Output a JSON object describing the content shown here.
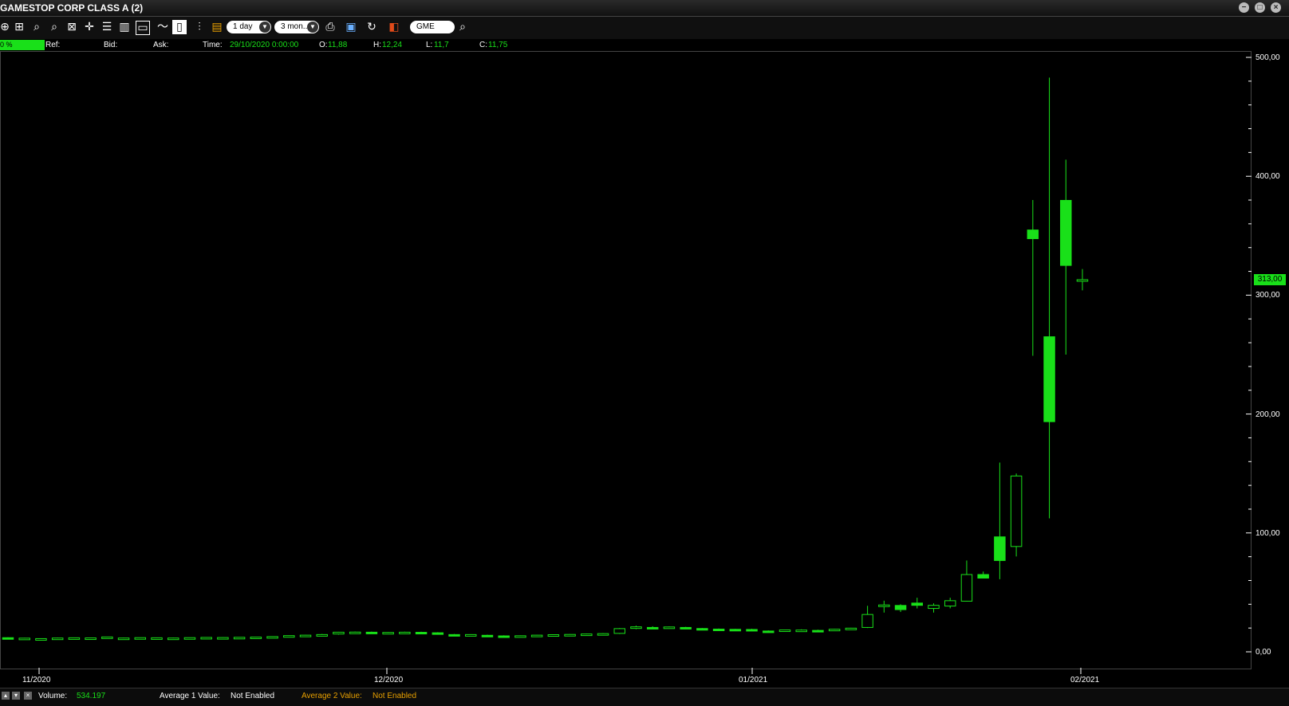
{
  "window": {
    "title": "GAMESTOP CORP CLASS A (2)"
  },
  "toolbar": {
    "interval": "1 day",
    "range": "3 mon..",
    "symbol": "GME",
    "icons": [
      "zoom-in-icon",
      "zoom-fit-icon",
      "zoom-in-alt-icon",
      "zoom-out-icon",
      "zoom-reset-icon",
      "crosshair-icon",
      "list-icon",
      "grid-icon",
      "window-icon",
      "line-chart-icon",
      "candlestick-icon",
      "bars-icon",
      "settings-icon",
      "print-icon",
      "save-icon",
      "refresh-icon",
      "color-icon",
      "search-icon"
    ]
  },
  "info": {
    "pct": "0 %",
    "ref_label": "Ref:",
    "bid_label": "Bid:",
    "ask_label": "Ask:",
    "time_label": "Time:",
    "time_value": "29/10/2020 0:00:00",
    "open_label": "O:",
    "open_value": "11,88",
    "high_label": "H:",
    "high_value": "12,24",
    "low_label": "L:",
    "low_value": "11,7",
    "close_label": "C:",
    "close_value": "11,75"
  },
  "axis": {
    "y_ticks": [
      "500,00",
      "400,00",
      "300,00",
      "200,00",
      "100,00",
      "0,00"
    ],
    "x_ticks": [
      "11/2020",
      "12/2020",
      "01/2021",
      "02/2021"
    ],
    "last_price": "313,00"
  },
  "bottom": {
    "volume_label": "Volume:",
    "volume_value": "534.197",
    "avg1_label": "Average 1 Value:",
    "avg1_value": "Not Enabled",
    "avg2_label": "Average 2 Value:",
    "avg2_value": "Not Enabled"
  },
  "colors": {
    "up": "#19e019",
    "background": "#000000",
    "axis": "#ffffff"
  },
  "chart_data": {
    "type": "candlestick",
    "title": "GAMESTOP CORP CLASS A (2)",
    "ylim": [
      0,
      500
    ],
    "x_ticks": [
      "11/2020",
      "12/2020",
      "01/2021",
      "02/2021"
    ],
    "candles": [
      {
        "o": 11.88,
        "h": 12.24,
        "l": 11.7,
        "c": 11.75
      },
      {
        "o": 11.2,
        "h": 11.8,
        "l": 10.9,
        "c": 11.5
      },
      {
        "o": 10.9,
        "h": 11.4,
        "l": 10.5,
        "c": 11.1
      },
      {
        "o": 11.2,
        "h": 11.9,
        "l": 10.9,
        "c": 11.6
      },
      {
        "o": 11.5,
        "h": 12.0,
        "l": 11.1,
        "c": 11.8
      },
      {
        "o": 11.3,
        "h": 11.9,
        "l": 11.0,
        "c": 11.7
      },
      {
        "o": 12.1,
        "h": 12.7,
        "l": 11.7,
        "c": 12.5
      },
      {
        "o": 11.4,
        "h": 11.9,
        "l": 11.0,
        "c": 11.6
      },
      {
        "o": 11.6,
        "h": 12.1,
        "l": 11.2,
        "c": 11.9
      },
      {
        "o": 11.5,
        "h": 12.0,
        "l": 11.2,
        "c": 11.8
      },
      {
        "o": 11.3,
        "h": 11.9,
        "l": 11.0,
        "c": 11.6
      },
      {
        "o": 11.6,
        "h": 12.1,
        "l": 11.3,
        "c": 11.9
      },
      {
        "o": 11.8,
        "h": 12.3,
        "l": 11.4,
        "c": 12.1
      },
      {
        "o": 11.7,
        "h": 12.2,
        "l": 11.4,
        "c": 12.0
      },
      {
        "o": 11.9,
        "h": 12.4,
        "l": 11.6,
        "c": 12.2
      },
      {
        "o": 12.0,
        "h": 12.6,
        "l": 11.7,
        "c": 12.4
      },
      {
        "o": 12.4,
        "h": 13.0,
        "l": 12.0,
        "c": 12.8
      },
      {
        "o": 13.0,
        "h": 13.8,
        "l": 12.6,
        "c": 13.6
      },
      {
        "o": 13.6,
        "h": 14.3,
        "l": 13.2,
        "c": 14.0
      },
      {
        "o": 14.0,
        "h": 15.0,
        "l": 13.6,
        "c": 14.5
      },
      {
        "o": 15.0,
        "h": 16.8,
        "l": 14.5,
        "c": 16.5
      },
      {
        "o": 16.4,
        "h": 17.0,
        "l": 15.9,
        "c": 16.6
      },
      {
        "o": 16.5,
        "h": 17.0,
        "l": 15.8,
        "c": 16.2
      },
      {
        "o": 16.1,
        "h": 16.6,
        "l": 15.6,
        "c": 16.3
      },
      {
        "o": 16.3,
        "h": 16.9,
        "l": 15.9,
        "c": 16.5
      },
      {
        "o": 16.4,
        "h": 16.9,
        "l": 15.9,
        "c": 16.1
      },
      {
        "o": 16.0,
        "h": 16.5,
        "l": 15.5,
        "c": 15.8
      },
      {
        "o": 14.5,
        "h": 15.0,
        "l": 14.0,
        "c": 14.3
      },
      {
        "o": 14.2,
        "h": 14.8,
        "l": 13.8,
        "c": 14.5
      },
      {
        "o": 13.9,
        "h": 14.4,
        "l": 13.3,
        "c": 13.6
      },
      {
        "o": 13.4,
        "h": 13.9,
        "l": 12.9,
        "c": 13.2
      },
      {
        "o": 13.3,
        "h": 13.8,
        "l": 12.9,
        "c": 13.5
      },
      {
        "o": 13.6,
        "h": 14.2,
        "l": 13.2,
        "c": 14.0
      },
      {
        "o": 14.0,
        "h": 14.6,
        "l": 13.6,
        "c": 14.4
      },
      {
        "o": 14.3,
        "h": 14.9,
        "l": 13.9,
        "c": 14.6
      },
      {
        "o": 14.5,
        "h": 15.3,
        "l": 14.1,
        "c": 15.0
      },
      {
        "o": 15.0,
        "h": 15.7,
        "l": 14.6,
        "c": 15.3
      },
      {
        "o": 15.5,
        "h": 20.0,
        "l": 15.0,
        "c": 19.5
      },
      {
        "o": 20.0,
        "h": 22.0,
        "l": 19.0,
        "c": 21.0
      },
      {
        "o": 20.5,
        "h": 21.5,
        "l": 19.8,
        "c": 20.3
      },
      {
        "o": 20.2,
        "h": 21.3,
        "l": 19.7,
        "c": 20.9
      },
      {
        "o": 20.5,
        "h": 21.0,
        "l": 19.3,
        "c": 19.6
      },
      {
        "o": 19.6,
        "h": 20.0,
        "l": 18.8,
        "c": 19.0
      },
      {
        "o": 19.1,
        "h": 19.6,
        "l": 18.5,
        "c": 18.9
      },
      {
        "o": 18.9,
        "h": 19.3,
        "l": 18.2,
        "c": 18.5
      },
      {
        "o": 18.8,
        "h": 19.4,
        "l": 17.6,
        "c": 17.7
      },
      {
        "o": 17.5,
        "h": 18.0,
        "l": 17.0,
        "c": 17.3
      },
      {
        "o": 17.3,
        "h": 18.5,
        "l": 17.0,
        "c": 18.4
      },
      {
        "o": 18.2,
        "h": 18.9,
        "l": 17.6,
        "c": 18.3
      },
      {
        "o": 18.0,
        "h": 18.6,
        "l": 17.5,
        "c": 17.7
      },
      {
        "o": 18.0,
        "h": 19.3,
        "l": 17.8,
        "c": 19.0
      },
      {
        "o": 19.1,
        "h": 20.2,
        "l": 18.5,
        "c": 19.9
      },
      {
        "o": 20.5,
        "h": 38.7,
        "l": 20.0,
        "c": 31.4
      },
      {
        "o": 38.5,
        "h": 43.0,
        "l": 33.0,
        "c": 39.4
      },
      {
        "o": 39.0,
        "h": 40.0,
        "l": 33.5,
        "c": 35.5
      },
      {
        "o": 41.0,
        "h": 45.5,
        "l": 36.5,
        "c": 39.1
      },
      {
        "o": 36.5,
        "h": 40.8,
        "l": 33.0,
        "c": 39.1
      },
      {
        "o": 38.5,
        "h": 45.5,
        "l": 36.6,
        "c": 43.0
      },
      {
        "o": 42.6,
        "h": 76.8,
        "l": 42.3,
        "c": 65.0
      },
      {
        "o": 65.0,
        "h": 67.5,
        "l": 62.0,
        "c": 62.0
      },
      {
        "o": 96.7,
        "h": 159.2,
        "l": 61.1,
        "c": 76.8
      },
      {
        "o": 88.6,
        "h": 150.0,
        "l": 80.2,
        "c": 147.9
      },
      {
        "o": 354.8,
        "h": 380.0,
        "l": 249.0,
        "c": 347.5
      },
      {
        "o": 265.0,
        "h": 483.0,
        "l": 112.3,
        "c": 193.6
      },
      {
        "o": 379.7,
        "h": 413.98,
        "l": 250.0,
        "c": 325.0
      },
      {
        "o": 313.0,
        "h": 322.0,
        "l": 304.0,
        "c": 313.0
      }
    ]
  }
}
